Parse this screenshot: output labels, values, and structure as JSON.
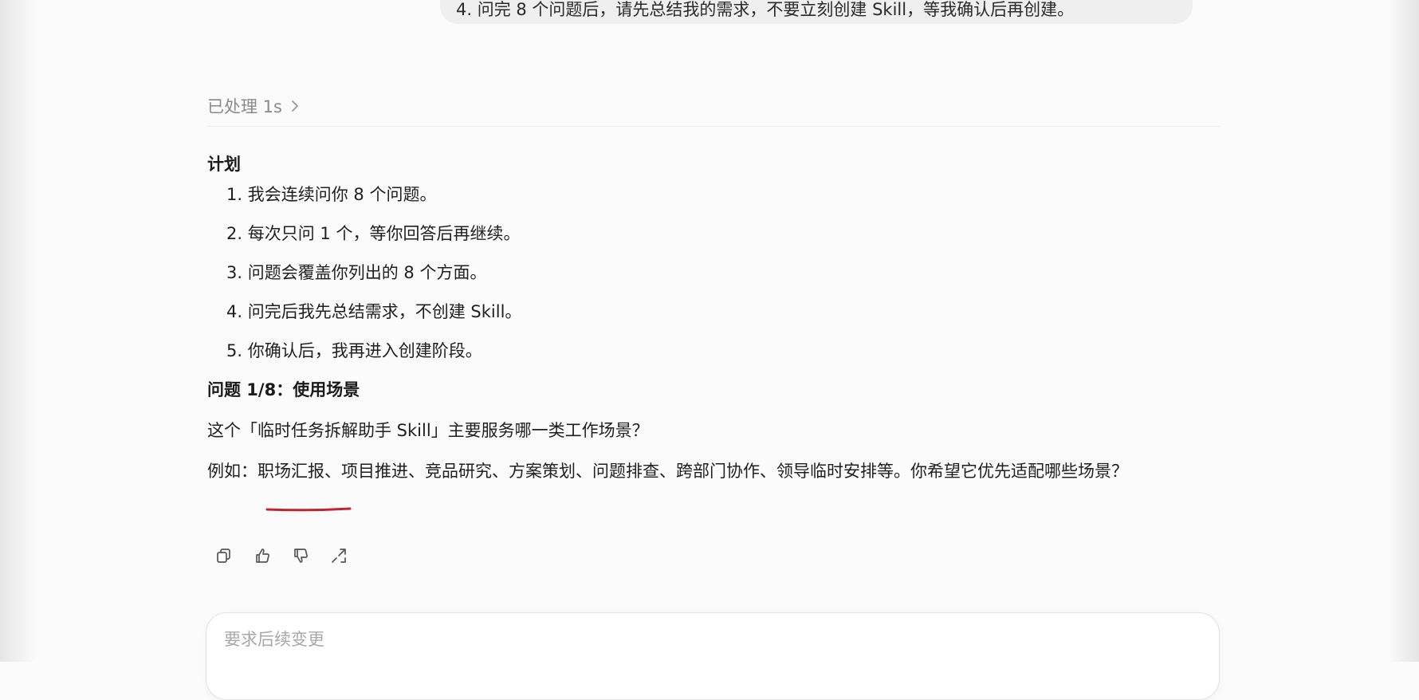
{
  "user_message": {
    "text": "4. 问完 8 个问题后，请先总结我的需求，不要立刻创建 Skill，等我确认后再创建。"
  },
  "processed": {
    "label": "已处理 1s",
    "icon": "chevron-right-icon"
  },
  "plan": {
    "heading": "计划",
    "items": [
      {
        "num": "1.",
        "text": "我会连续问你 8 个问题。"
      },
      {
        "num": "2.",
        "text": "每次只问 1 个，等你回答后再继续。"
      },
      {
        "num": "3.",
        "text": "问题会覆盖你列出的 8 个方面。"
      },
      {
        "num": "4.",
        "text": "问完后我先总结需求，不创建 Skill。"
      },
      {
        "num": "5.",
        "text": "你确认后，我再进入创建阶段。"
      }
    ]
  },
  "question": {
    "heading": "问题 1/8：使用场景",
    "text": "这个「临时任务拆解助手 Skill」主要服务哪一类工作场景？",
    "example": "例如：职场汇报、项目推进、竞品研究、方案策划、问题排查、跨部门协作、领导临时安排等。你希望它优先适配哪些场景？"
  },
  "actions": [
    {
      "name": "copy-icon"
    },
    {
      "name": "thumbs-up-icon"
    },
    {
      "name": "thumbs-down-icon"
    },
    {
      "name": "share-icon"
    }
  ],
  "composer": {
    "placeholder": "要求后续变更"
  },
  "colors": {
    "underline_mark": "#c0262c",
    "muted_text": "#8a8a8a",
    "bubble_bg": "#efefef"
  }
}
